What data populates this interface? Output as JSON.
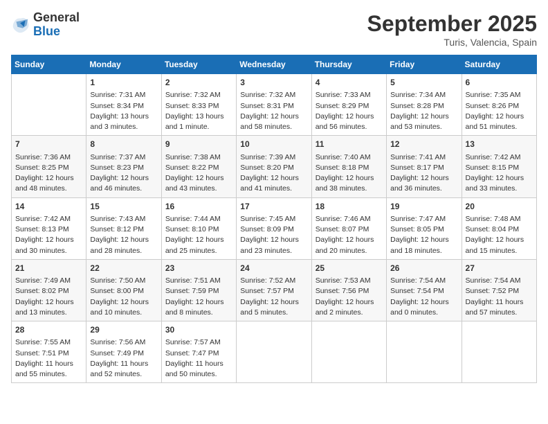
{
  "header": {
    "logo_general": "General",
    "logo_blue": "Blue",
    "month": "September 2025",
    "location": "Turis, Valencia, Spain"
  },
  "days_of_week": [
    "Sunday",
    "Monday",
    "Tuesday",
    "Wednesday",
    "Thursday",
    "Friday",
    "Saturday"
  ],
  "weeks": [
    [
      {
        "day": "",
        "empty": true
      },
      {
        "day": "1",
        "sunrise": "7:31 AM",
        "sunset": "8:34 PM",
        "daylight": "13 hours and 3 minutes."
      },
      {
        "day": "2",
        "sunrise": "7:32 AM",
        "sunset": "8:33 PM",
        "daylight": "13 hours and 1 minute."
      },
      {
        "day": "3",
        "sunrise": "7:32 AM",
        "sunset": "8:31 PM",
        "daylight": "12 hours and 58 minutes."
      },
      {
        "day": "4",
        "sunrise": "7:33 AM",
        "sunset": "8:29 PM",
        "daylight": "12 hours and 56 minutes."
      },
      {
        "day": "5",
        "sunrise": "7:34 AM",
        "sunset": "8:28 PM",
        "daylight": "12 hours and 53 minutes."
      },
      {
        "day": "6",
        "sunrise": "7:35 AM",
        "sunset": "8:26 PM",
        "daylight": "12 hours and 51 minutes."
      }
    ],
    [
      {
        "day": "7",
        "sunrise": "7:36 AM",
        "sunset": "8:25 PM",
        "daylight": "12 hours and 48 minutes."
      },
      {
        "day": "8",
        "sunrise": "7:37 AM",
        "sunset": "8:23 PM",
        "daylight": "12 hours and 46 minutes."
      },
      {
        "day": "9",
        "sunrise": "7:38 AM",
        "sunset": "8:22 PM",
        "daylight": "12 hours and 43 minutes."
      },
      {
        "day": "10",
        "sunrise": "7:39 AM",
        "sunset": "8:20 PM",
        "daylight": "12 hours and 41 minutes."
      },
      {
        "day": "11",
        "sunrise": "7:40 AM",
        "sunset": "8:18 PM",
        "daylight": "12 hours and 38 minutes."
      },
      {
        "day": "12",
        "sunrise": "7:41 AM",
        "sunset": "8:17 PM",
        "daylight": "12 hours and 36 minutes."
      },
      {
        "day": "13",
        "sunrise": "7:42 AM",
        "sunset": "8:15 PM",
        "daylight": "12 hours and 33 minutes."
      }
    ],
    [
      {
        "day": "14",
        "sunrise": "7:42 AM",
        "sunset": "8:13 PM",
        "daylight": "12 hours and 30 minutes."
      },
      {
        "day": "15",
        "sunrise": "7:43 AM",
        "sunset": "8:12 PM",
        "daylight": "12 hours and 28 minutes."
      },
      {
        "day": "16",
        "sunrise": "7:44 AM",
        "sunset": "8:10 PM",
        "daylight": "12 hours and 25 minutes."
      },
      {
        "day": "17",
        "sunrise": "7:45 AM",
        "sunset": "8:09 PM",
        "daylight": "12 hours and 23 minutes."
      },
      {
        "day": "18",
        "sunrise": "7:46 AM",
        "sunset": "8:07 PM",
        "daylight": "12 hours and 20 minutes."
      },
      {
        "day": "19",
        "sunrise": "7:47 AM",
        "sunset": "8:05 PM",
        "daylight": "12 hours and 18 minutes."
      },
      {
        "day": "20",
        "sunrise": "7:48 AM",
        "sunset": "8:04 PM",
        "daylight": "12 hours and 15 minutes."
      }
    ],
    [
      {
        "day": "21",
        "sunrise": "7:49 AM",
        "sunset": "8:02 PM",
        "daylight": "12 hours and 13 minutes."
      },
      {
        "day": "22",
        "sunrise": "7:50 AM",
        "sunset": "8:00 PM",
        "daylight": "12 hours and 10 minutes."
      },
      {
        "day": "23",
        "sunrise": "7:51 AM",
        "sunset": "7:59 PM",
        "daylight": "12 hours and 8 minutes."
      },
      {
        "day": "24",
        "sunrise": "7:52 AM",
        "sunset": "7:57 PM",
        "daylight": "12 hours and 5 minutes."
      },
      {
        "day": "25",
        "sunrise": "7:53 AM",
        "sunset": "7:56 PM",
        "daylight": "12 hours and 2 minutes."
      },
      {
        "day": "26",
        "sunrise": "7:54 AM",
        "sunset": "7:54 PM",
        "daylight": "12 hours and 0 minutes."
      },
      {
        "day": "27",
        "sunrise": "7:54 AM",
        "sunset": "7:52 PM",
        "daylight": "11 hours and 57 minutes."
      }
    ],
    [
      {
        "day": "28",
        "sunrise": "7:55 AM",
        "sunset": "7:51 PM",
        "daylight": "11 hours and 55 minutes."
      },
      {
        "day": "29",
        "sunrise": "7:56 AM",
        "sunset": "7:49 PM",
        "daylight": "11 hours and 52 minutes."
      },
      {
        "day": "30",
        "sunrise": "7:57 AM",
        "sunset": "7:47 PM",
        "daylight": "11 hours and 50 minutes."
      },
      {
        "day": "",
        "empty": true
      },
      {
        "day": "",
        "empty": true
      },
      {
        "day": "",
        "empty": true
      },
      {
        "day": "",
        "empty": true
      }
    ]
  ]
}
